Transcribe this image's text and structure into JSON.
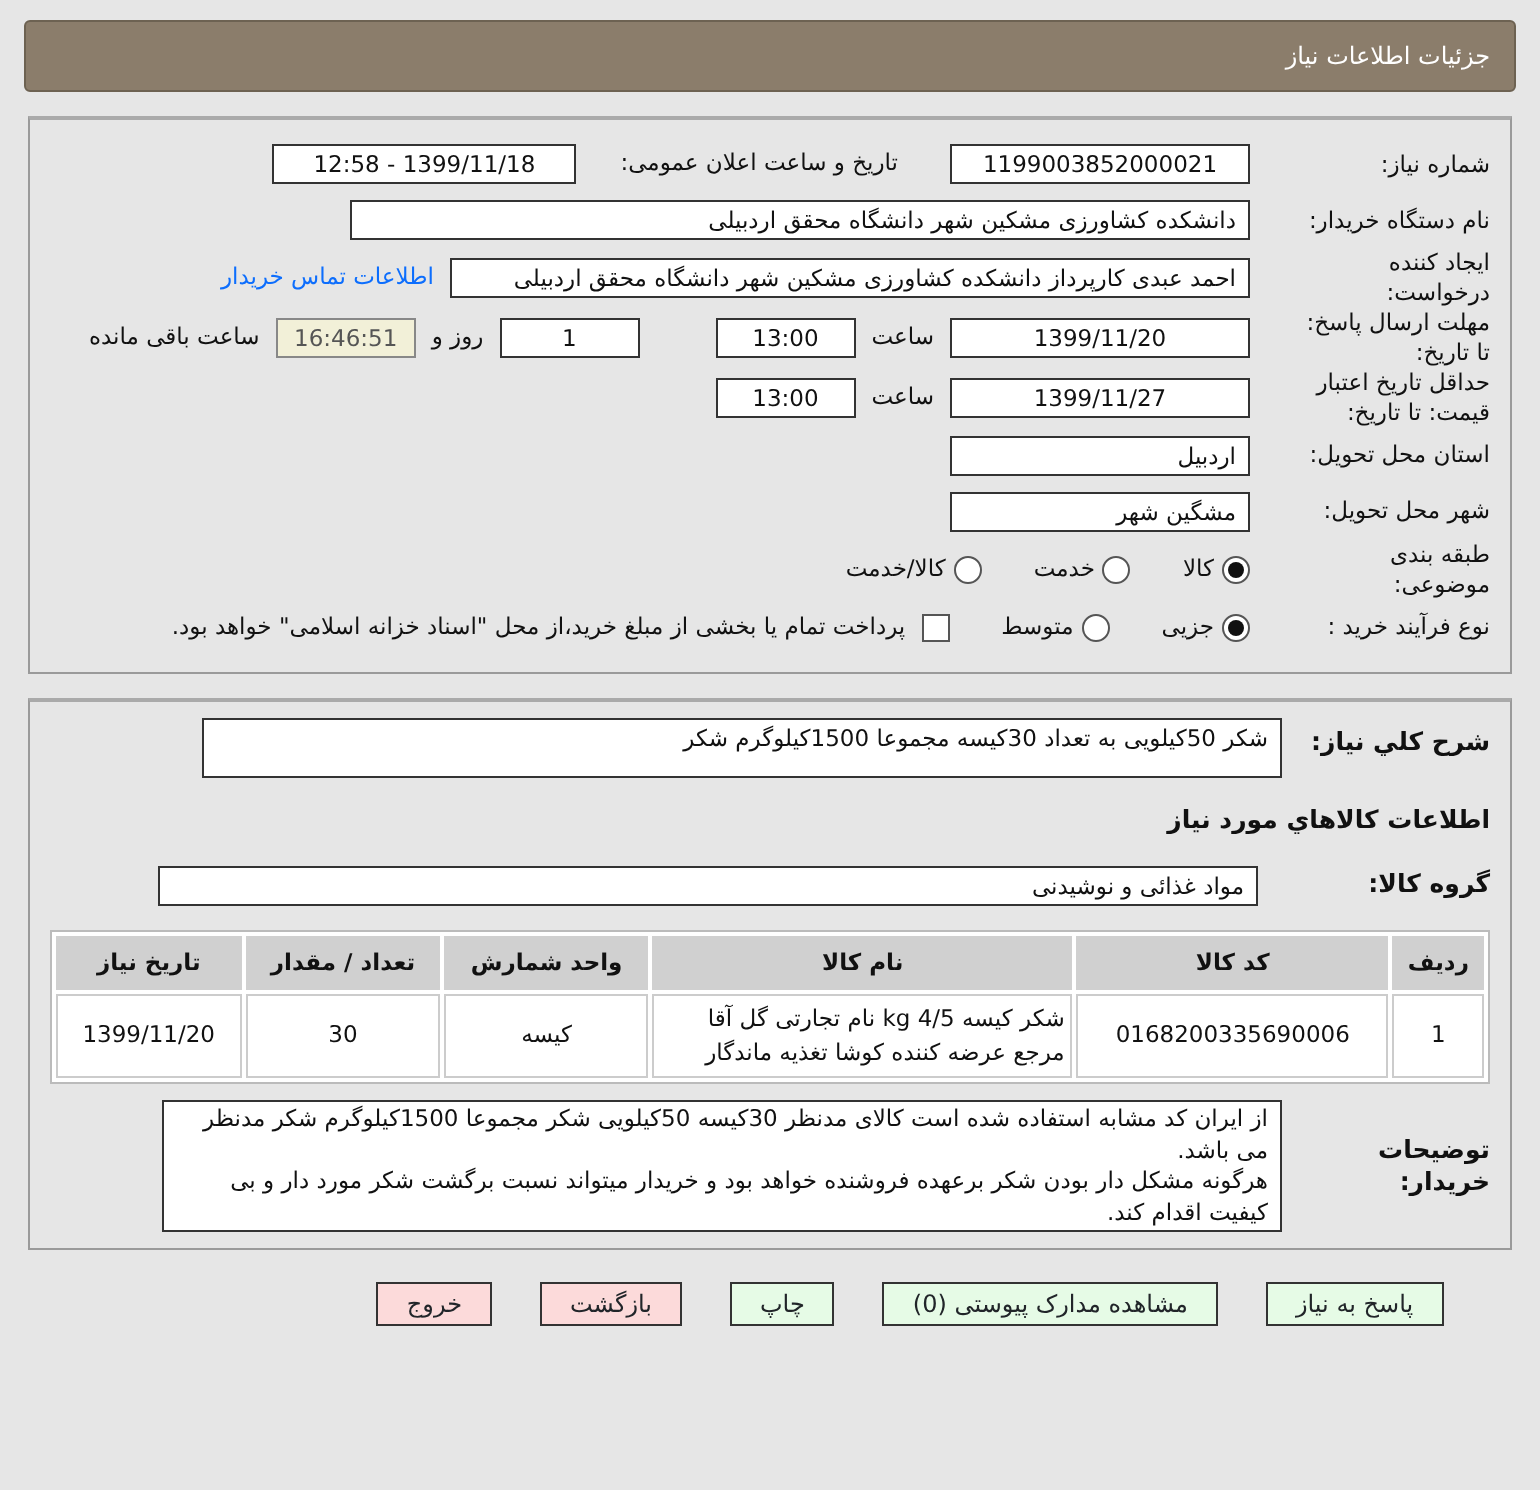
{
  "header": {
    "title": "جزئیات اطلاعات نیاز"
  },
  "need": {
    "number_label": "شماره نیاز:",
    "number": "1199003852000021",
    "announce_label": "تاریخ و ساعت اعلان عمومی:",
    "announce": "1399/11/18 - 12:58"
  },
  "buyer": {
    "label": "نام دستگاه خریدار:",
    "value": "دانشکده کشاورزی مشکین شهر دانشگاه محقق اردبیلی"
  },
  "requester": {
    "label": "ایجاد کننده درخواست:",
    "value": "احمد عبدی کارپرداز دانشکده کشاورزی مشکین شهر دانشگاه محقق اردبیلی",
    "link": "اطلاعات تماس خریدار"
  },
  "deadline": {
    "label": "مهلت ارسال پاسخ: تا تاریخ:",
    "date": "1399/11/20",
    "time_label": "ساعت",
    "time": "13:00",
    "days": "1",
    "days_label": "روز و",
    "remaining": "16:46:51",
    "remaining_label": "ساعت باقی مانده"
  },
  "validity": {
    "label": "حداقل تاریخ اعتبار قیمت: تا تاریخ:",
    "date": "1399/11/27",
    "time_label": "ساعت",
    "time": "13:00"
  },
  "province": {
    "label": "استان محل تحویل:",
    "value": "اردبیل"
  },
  "city": {
    "label": "شهر محل تحویل:",
    "value": "مشگین شهر"
  },
  "category": {
    "label": "طبقه بندی موضوعی:",
    "options": [
      {
        "label": "کالا",
        "selected": true
      },
      {
        "label": "خدمت",
        "selected": false
      },
      {
        "label": "کالا/خدمت",
        "selected": false
      }
    ]
  },
  "purchase": {
    "label": "نوع فرآیند خرید :",
    "options": [
      {
        "label": "جزیی",
        "selected": true
      },
      {
        "label": "متوسط",
        "selected": false
      }
    ],
    "treasury": {
      "checked": false,
      "text": "پرداخت تمام یا بخشی از مبلغ خرید،از محل \"اسناد خزانه اسلامی\" خواهد بود."
    }
  },
  "description": {
    "label": "شرح کلي نياز:",
    "value": "شکر 50کیلویی به تعداد 30کیسه مجموعا 1500کیلوگرم شکر"
  },
  "goods": {
    "title": "اطلاعات کالاهاي مورد نياز",
    "group_label": "گروه کالا:",
    "group": "مواد غذائی و نوشیدنی"
  },
  "table": {
    "columns": [
      "ردیف",
      "کد کالا",
      "نام کالا",
      "واحد شمارش",
      "تعداد / مقدار",
      "تاریخ نیاز"
    ],
    "rows": [
      [
        "1",
        "0168200335690006",
        "شکر کیسه 4/5 kg نام تجارتی گل آقا مرجع عرضه کننده کوشا تغذیه ماندگار",
        "کیسه",
        "30",
        "1399/11/20"
      ]
    ]
  },
  "notes": {
    "label": "توضیحات خریدار:",
    "lines": [
      "از ایران کد مشابه استفاده شده است کالای مدنظر 30کیسه 50کیلویی شکر مجموعا 1500کیلوگرم شکر مدنظر می باشد.",
      "هرگونه مشکل دار بودن شکر برعهده فروشنده خواهد بود و خریدار میتواند نسبت برگشت شکر مورد دار و بی کیفیت اقدام کند."
    ]
  },
  "buttons": [
    {
      "label": "پاسخ به نیاز",
      "kind": "green"
    },
    {
      "label": "مشاهده مدارک پیوستی (0)",
      "kind": "green"
    },
    {
      "label": "چاپ",
      "kind": "green"
    },
    {
      "label": "بازگشت",
      "kind": "red"
    },
    {
      "label": "خروج",
      "kind": "red"
    }
  ]
}
